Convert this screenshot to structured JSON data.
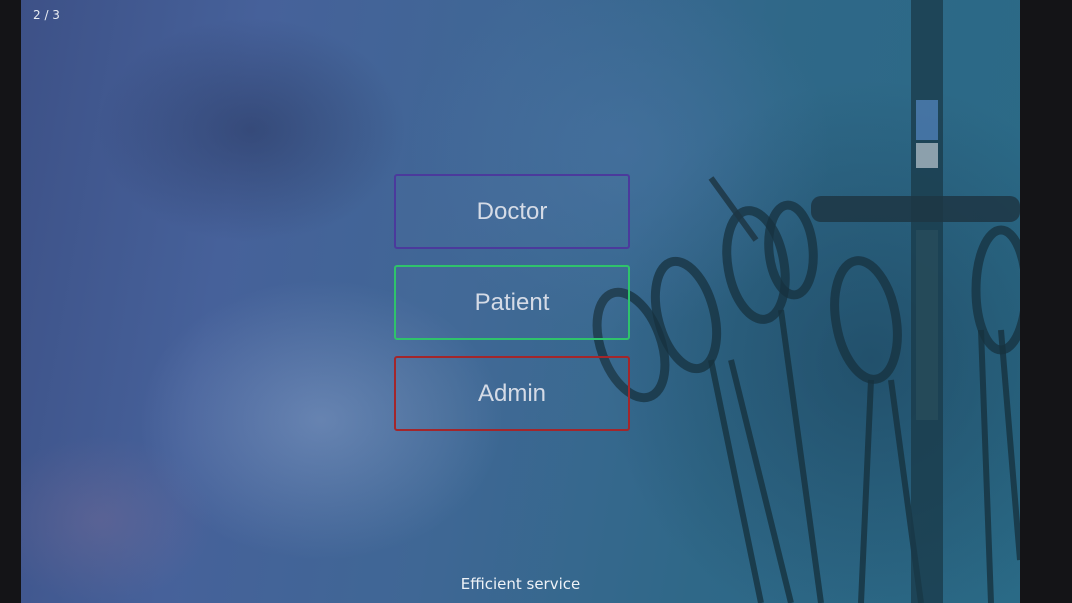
{
  "slideshow": {
    "counter": "2 / 3",
    "caption": "Efficient service"
  },
  "roles": {
    "doctor_label": "Doctor",
    "patient_label": "Patient",
    "admin_label": "Admin"
  },
  "colors": {
    "doctor_border": "#4b3a9c",
    "patient_border": "#2fc36b",
    "admin_border": "#a3262b"
  },
  "background": {
    "image_subject": "surgical-instruments-photo"
  }
}
